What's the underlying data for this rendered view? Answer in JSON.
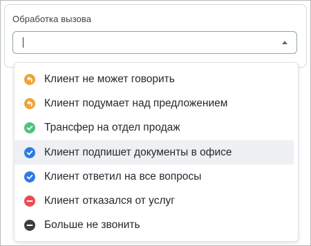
{
  "field": {
    "label": "Обработка вызова",
    "value": ""
  },
  "colors": {
    "orange": "#f0a33a",
    "green": "#4fc37d",
    "blue": "#2f7be3",
    "red": "#ef4a4f",
    "dark": "#3b3f44"
  },
  "options": [
    {
      "label": "Клиент не может говорить",
      "icon": "orange-return-icon"
    },
    {
      "label": "Клиент подумает над предложением",
      "icon": "orange-return-icon"
    },
    {
      "label": "Трансфер на отдел продаж",
      "icon": "green-check-icon"
    },
    {
      "label": "Клиент подпишет документы в офисе",
      "icon": "blue-check-icon",
      "highlighted": true
    },
    {
      "label": "Клиент ответил на все вопросы",
      "icon": "blue-check-icon"
    },
    {
      "label": "Клиент отказался от услуг",
      "icon": "red-minus-icon"
    },
    {
      "label": "Больше не звонить",
      "icon": "dark-minus-icon"
    }
  ]
}
